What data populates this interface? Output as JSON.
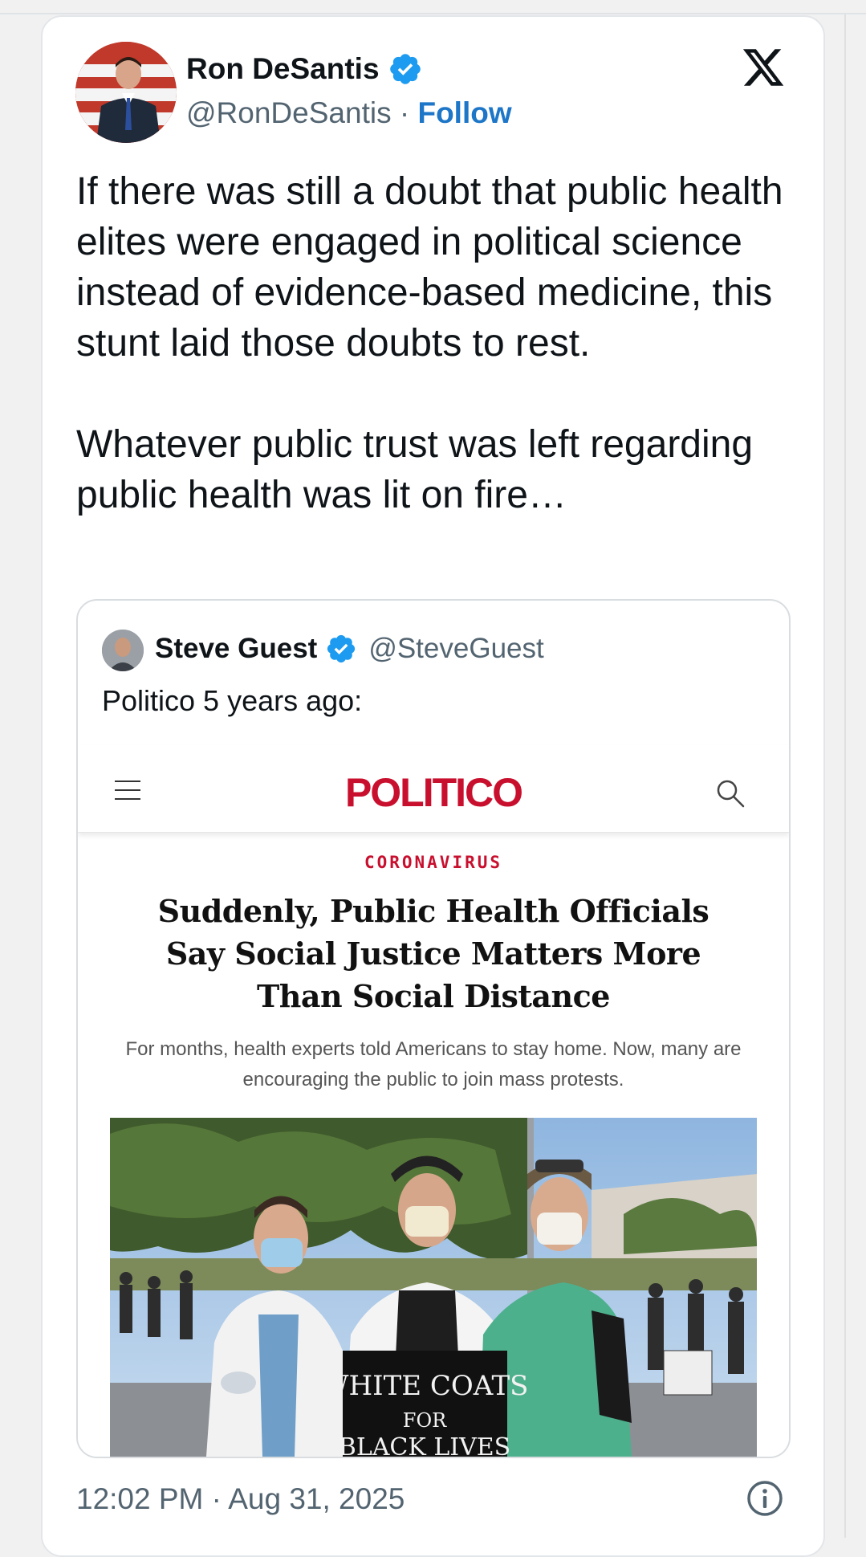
{
  "tweet": {
    "author_name": "Ron DeSantis",
    "author_handle": "@RonDeSantis",
    "separator": "·",
    "follow_label": "Follow",
    "text": "If there was still a doubt that public health elites were engaged in political science instead of evidence-based medicine, this stunt laid those doubts to rest.\n\nWhatever public trust was left regarding public health was lit on fire…",
    "timestamp": "12:02 PM · Aug 31, 2025",
    "icons": {
      "verified": "verified-badge-icon",
      "platform": "x-logo-icon",
      "info": "info-icon"
    },
    "colors": {
      "follow": "#1d76c7",
      "verified": "#1d9bf0",
      "text": "#0f1419",
      "secondary": "#536471"
    }
  },
  "quote": {
    "author_name": "Steve Guest",
    "author_handle": "@SteveGuest",
    "text": "Politico 5 years ago:",
    "article": {
      "site_logo": "POLITICO",
      "section": "CORONAVIRUS",
      "headline": "Suddenly, Public Health Officials Say Social Justice Matters More Than Social Distance",
      "dek": "For months, health experts told Americans to stay home. Now, many are encouraging the public to join mass protests.",
      "photo_sign_text": "WHITE COATS FOR BLACK LIVES",
      "colors": {
        "brand": "#c8102e"
      }
    }
  }
}
